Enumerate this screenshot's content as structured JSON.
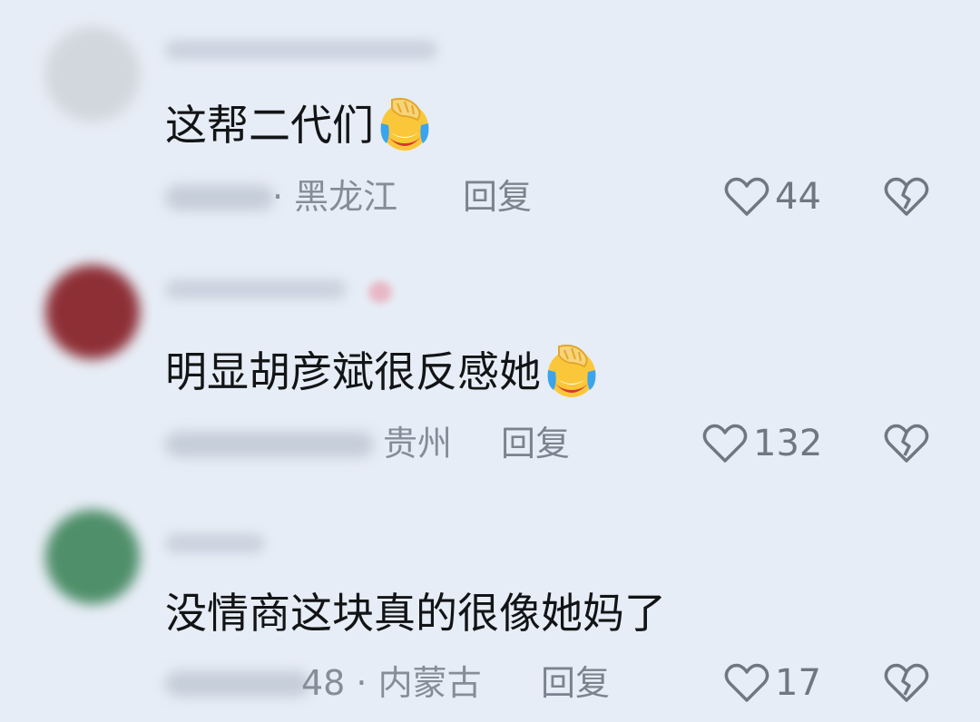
{
  "comments": [
    {
      "text": "这帮二代们",
      "has_emoji": true,
      "emoji_icon": "facepalm-laugh-crying-emoji",
      "location": "· 黑龙江",
      "reply_label": "回复",
      "likes": "44",
      "avatar_color": "#d2d6dd"
    },
    {
      "text": "明显胡彦斌很反感她",
      "has_emoji": true,
      "emoji_icon": "facepalm-laugh-crying-emoji",
      "location": "贵州",
      "reply_label": "回复",
      "likes": "132",
      "avatar_color": "#8e2f36"
    },
    {
      "text": "没情商这块真的很像她妈了",
      "has_emoji": false,
      "location": "48 · 内蒙古",
      "reply_label": "回复",
      "likes": "17",
      "avatar_color": "#4f8f6a"
    }
  ],
  "icons": {
    "like": "heart-outline-icon",
    "dislike": "broken-heart-icon"
  },
  "colors": {
    "background": "#e7edf6",
    "text": "#121416",
    "meta": "#858d99"
  }
}
